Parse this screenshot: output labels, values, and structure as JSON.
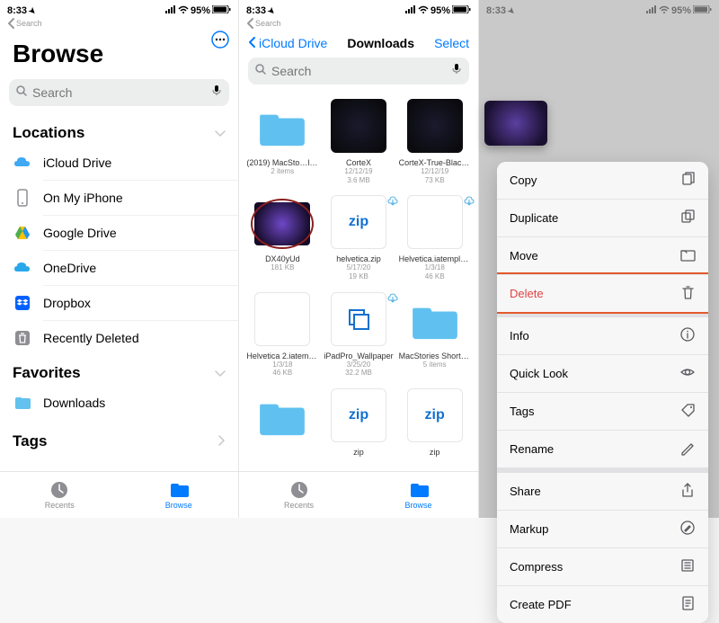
{
  "status": {
    "time": "8:33",
    "battery": "95%"
  },
  "nav_back_small": "Search",
  "panel1": {
    "title": "Browse",
    "search_placeholder": "Search",
    "locations_label": "Locations",
    "locations": [
      {
        "label": "iCloud Drive",
        "icon": "icloud"
      },
      {
        "label": "On My iPhone",
        "icon": "iphone"
      },
      {
        "label": "Google Drive",
        "icon": "gdrive"
      },
      {
        "label": "OneDrive",
        "icon": "onedrive"
      },
      {
        "label": "Dropbox",
        "icon": "dropbox"
      },
      {
        "label": "Recently Deleted",
        "icon": "trash"
      }
    ],
    "favorites_label": "Favorites",
    "favorites": [
      {
        "label": "Downloads",
        "icon": "folder"
      }
    ],
    "tags_label": "Tags"
  },
  "tabs": {
    "recents": "Recents",
    "browse": "Browse"
  },
  "panel2": {
    "back": "iCloud Drive",
    "title": "Downloads",
    "select": "Select",
    "search_placeholder": "Search",
    "items": [
      {
        "name": "(2019) MacSto…llpapers",
        "meta1": "2 items",
        "type": "folder"
      },
      {
        "name": "CorteX",
        "meta1": "12/12/19",
        "meta2": "3.6 MB",
        "type": "dark"
      },
      {
        "name": "CorteX-True-Black-Neon",
        "meta1": "12/12/19",
        "meta2": "73 KB",
        "type": "dark"
      },
      {
        "name": "DX40yUd",
        "meta1": "181 KB",
        "type": "image",
        "highlight": true
      },
      {
        "name": "helvetica.zip",
        "meta1": "5/17/20",
        "meta2": "19 KB",
        "type": "zip",
        "cloud": true
      },
      {
        "name": "Helvetica.iatemplate",
        "meta1": "1/3/18",
        "meta2": "46 KB",
        "type": "iatemp",
        "cloud": true
      },
      {
        "name": "Helvetica 2.iatemplate",
        "meta1": "1/3/18",
        "meta2": "46 KB",
        "type": "iatemp"
      },
      {
        "name": "iPadPro_Wallpaper",
        "meta1": "3/25/20",
        "meta2": "32.2 MB",
        "type": "ipad",
        "cloud": true
      },
      {
        "name": "MacStories Shortcuts Icons",
        "meta1": "5 items",
        "type": "folder"
      },
      {
        "name": "",
        "type": "folder"
      },
      {
        "name": "zip",
        "type": "zip"
      },
      {
        "name": "zip",
        "type": "zip"
      }
    ]
  },
  "panel3": {
    "menu": [
      {
        "label": "Copy",
        "icon": "copy"
      },
      {
        "label": "Duplicate",
        "icon": "duplicate"
      },
      {
        "label": "Move",
        "icon": "move"
      },
      {
        "label": "Delete",
        "icon": "trash",
        "danger": true
      },
      {
        "label": "Info",
        "icon": "info",
        "gap": true
      },
      {
        "label": "Quick Look",
        "icon": "eye"
      },
      {
        "label": "Tags",
        "icon": "tag"
      },
      {
        "label": "Rename",
        "icon": "pencil"
      },
      {
        "label": "Share",
        "icon": "share",
        "gap": true
      },
      {
        "label": "Markup",
        "icon": "markup"
      },
      {
        "label": "Compress",
        "icon": "compress"
      },
      {
        "label": "Create PDF",
        "icon": "pdf"
      }
    ]
  }
}
